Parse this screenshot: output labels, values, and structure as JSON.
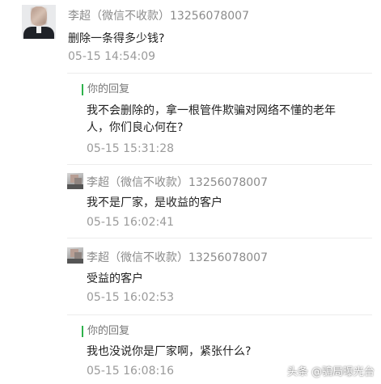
{
  "main_comment": {
    "name": "李超（微信不收款）13256078007",
    "text": "删除一条得多少钱?",
    "time": "05-15 14:54:09"
  },
  "replies": [
    {
      "label": "你的回复",
      "text_line1": "我不会删除的，拿一根管件欺骗对网络不懂的老年",
      "text_line2": "人，你们良心何在?",
      "time": "05-15 15:31:28"
    },
    {
      "name": "李超（微信不收款）13256078007",
      "text": "我不是厂家，是收益的客户",
      "time": "05-15 16:02:41"
    },
    {
      "name": "李超（微信不收款）13256078007",
      "text": "受益的客户",
      "time": "05-15 16:02:53"
    },
    {
      "label": "你的回复",
      "text": "我也没说你是厂家啊，紧张什么?",
      "time": "05-15 16:08:16"
    }
  ],
  "watermark": "头条 @骗局曝光台",
  "colors": {
    "reply_bar": "#2db24b",
    "name": "#8b8b8b",
    "time": "#9a9a9a",
    "text": "#222222",
    "divider": "#ececec"
  }
}
